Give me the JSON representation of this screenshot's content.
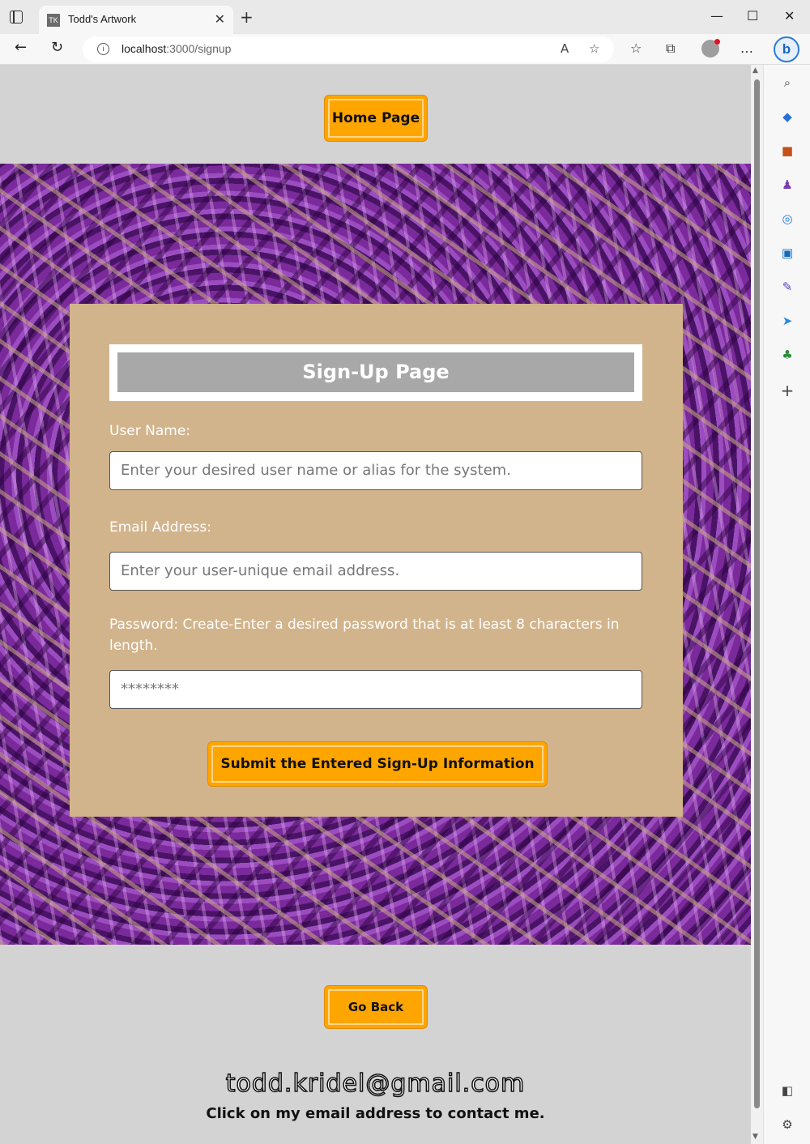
{
  "browser": {
    "tab_title": "Todd's Artwork",
    "tab_favicon": "TK",
    "url_host": "localhost",
    "url_rest": ":3000/signup",
    "new_tab_glyph": "+",
    "close_glyph": "✕"
  },
  "page": {
    "home_button": "Home Page",
    "form": {
      "title": "Sign-Up Page",
      "username_label": "User Name:",
      "username_placeholder": "Enter your desired user name or alias for the system.",
      "email_label": "Email Address:",
      "email_placeholder": "Enter your user-unique email address.",
      "password_label": "Password: Create-Enter a desired password that is at least 8 characters in length.",
      "password_placeholder": "********",
      "submit_button": "Submit the Entered Sign-Up Information"
    },
    "go_back_button": "Go Back",
    "contact_email": "todd.kridel@gmail.com",
    "contact_note": "Click on my email address to contact me."
  },
  "colors": {
    "page_bg": "#d3d3d3",
    "button": "#ffa500",
    "form_card": "#d2b48c",
    "heading_bar": "#a8a8a8",
    "art_bg": "#6a1f8a"
  }
}
